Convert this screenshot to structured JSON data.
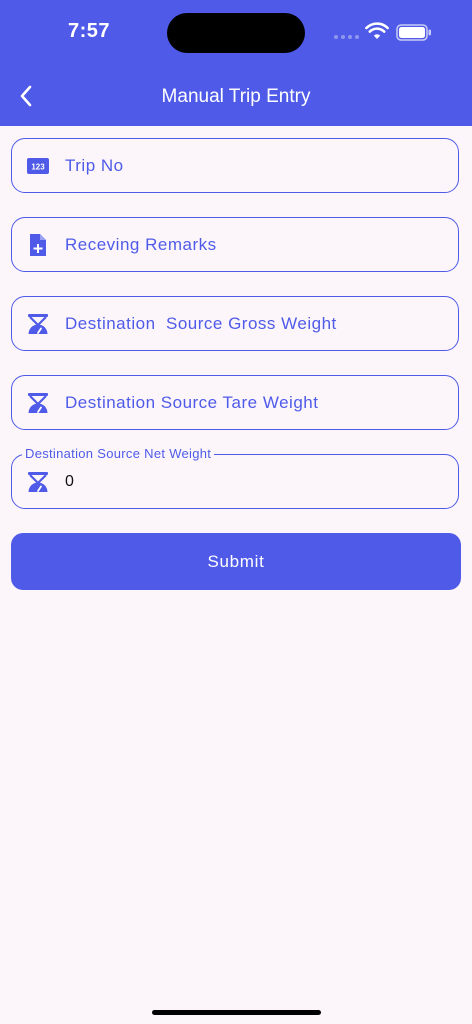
{
  "status_bar": {
    "time": "7:57"
  },
  "header": {
    "title": "Manual Trip Entry"
  },
  "form": {
    "trip_no": {
      "placeholder": "Trip No",
      "icon": "numbers-icon"
    },
    "receiving_remarks": {
      "placeholder": "Receving Remarks",
      "icon": "note-add-icon"
    },
    "gross_weight": {
      "placeholder": "Destination  Source Gross Weight",
      "icon": "scale-icon"
    },
    "tare_weight": {
      "placeholder": "Destination Source Tare Weight",
      "icon": "scale-icon"
    },
    "net_weight": {
      "label": "Destination Source Net Weight",
      "value": "0",
      "icon": "scale-icon"
    },
    "submit_label": "Submit"
  },
  "colors": {
    "accent": "#4f5be8",
    "background": "#fcf6fb"
  }
}
